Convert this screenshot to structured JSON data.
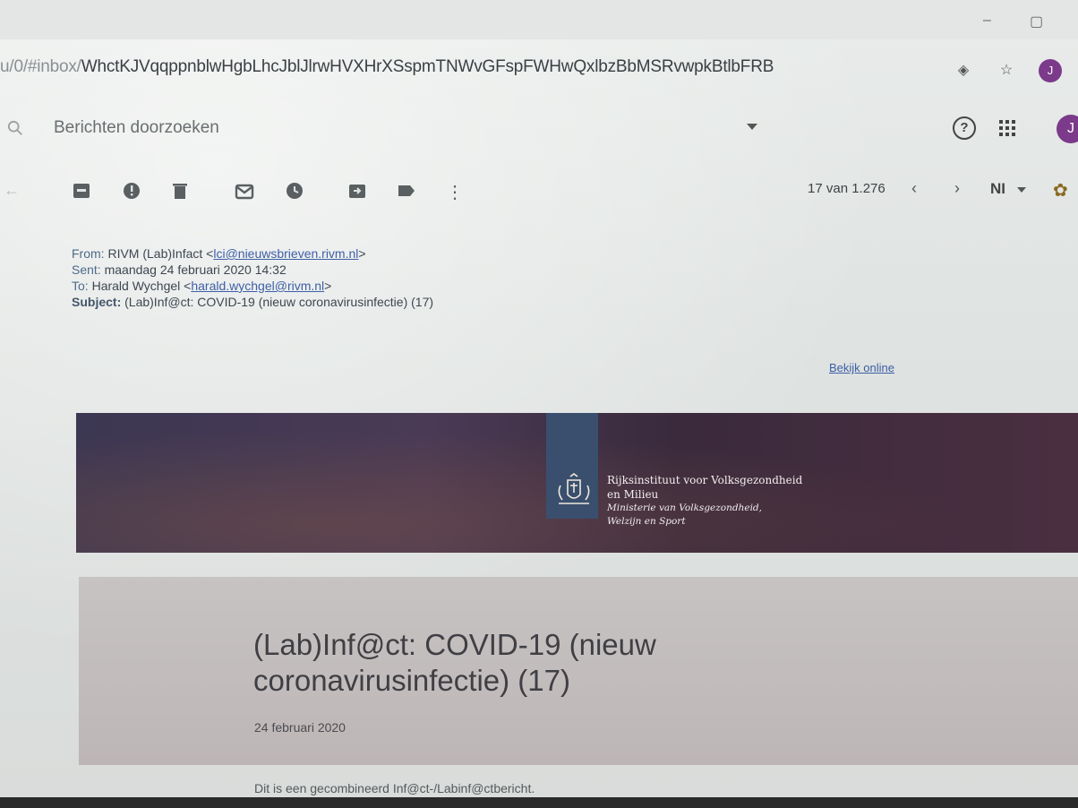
{
  "browser": {
    "url_prefix": "u/0/#inbox/",
    "url_id": "WhctKJVqqppnblwHgbLhcJblJlrwHVXHrXSspmTNWvGFspFWHwQxlbzBbMSRvwpkBtlbFRB",
    "avatar_letter": "J"
  },
  "gmail": {
    "search_placeholder": "Berichten doorzoeken",
    "avatar_letter": "J",
    "pager": "17 van 1.276",
    "lang": "NI"
  },
  "email": {
    "from_label": "From:",
    "from_name": "RIVM (Lab)Infact <",
    "from_email": "lci@nieuwsbrieven.rivm.nl",
    "from_close": ">",
    "sent_label": "Sent:",
    "sent_value": "maandag 24 februari 2020 14:32",
    "to_label": "To:",
    "to_name": "Harald Wychgel <",
    "to_email": "harald.wychgel@rivm.nl",
    "to_close": ">",
    "subject_label": "Subject:",
    "subject_value": "(Lab)Inf@ct: COVID-19 (nieuw coronavirusinfectie) (17)",
    "view_online": "Bekijk online"
  },
  "banner": {
    "org_line1": "Rijksinstituut voor Volksgezondheid",
    "org_line2": "en Milieu",
    "ministry_line1": "Ministerie van Volksgezondheid,",
    "ministry_line2": "Welzijn en Sport"
  },
  "newsletter": {
    "title": "(Lab)Inf@ct: COVID-19 (nieuw coronavirusinfectie) (17)",
    "date": "24 februari 2020",
    "body_start": "Dit is een gecombineerd Inf@ct-/Labinf@ctbericht."
  },
  "colors": {
    "link": "#3d5fa6",
    "banner_dark": "#3c3752",
    "ribbon": "#3a4f6e",
    "avatar": "#7b3a8a"
  }
}
